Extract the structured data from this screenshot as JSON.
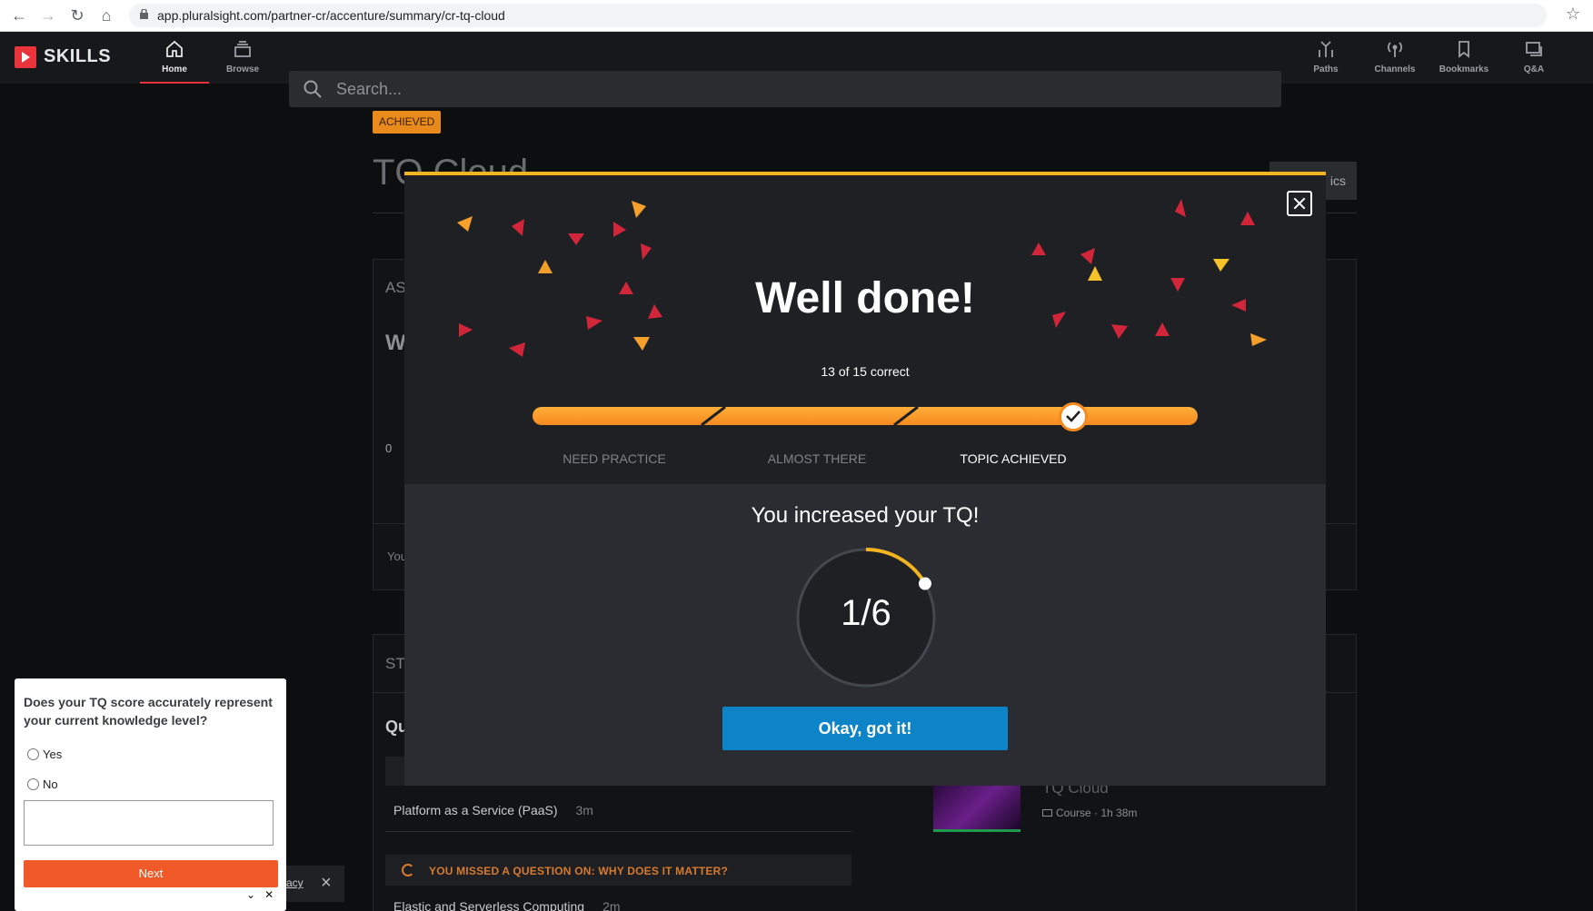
{
  "browser": {
    "url": "app.pluralsight.com/partner-cr/accenture/summary/cr-tq-cloud"
  },
  "header": {
    "logo": "SKILLS",
    "nav": [
      {
        "label": "Home",
        "icon": "home-icon"
      },
      {
        "label": "Browse",
        "icon": "browse-icon"
      },
      {
        "label": "Paths",
        "icon": "paths-icon"
      },
      {
        "label": "Channels",
        "icon": "channels-icon"
      },
      {
        "label": "Bookmarks",
        "icon": "bookmark-icon"
      },
      {
        "label": "Q&A",
        "icon": "qa-icon"
      }
    ],
    "search_placeholder": "Search..."
  },
  "page": {
    "badge": "ACHIEVED",
    "title": "TQ Cloud",
    "topics_button": "ics",
    "panel1_heading": "AS",
    "panel1_sub": "W",
    "panel1_axis": "0",
    "panel1_footer": "You",
    "panel2_heading": "ST",
    "panel2_sub": "Qu",
    "list": [
      {
        "title": "Platform as a Service (PaaS)",
        "time": "3m"
      },
      {
        "title": "Elastic and Serverless Computing",
        "time": "2m"
      }
    ],
    "missed_label": "YOU MISSED A QUESTION ON: WHY DOES IT MATTER?",
    "course": {
      "title": "TQ Cloud",
      "type": "Course",
      "duration": "1h 38m"
    }
  },
  "modal": {
    "headline": "Well done!",
    "score": "13 of 15 correct",
    "stages": [
      "NEED PRACTICE",
      "ALMOST THERE",
      "TOPIC ACHIEVED"
    ],
    "active_stage": "TOPIC ACHIEVED",
    "tq_title": "You increased your TQ!",
    "tq_value": "1/6",
    "tq_fraction": 0.1667,
    "ok_button": "Okay, got it!",
    "colors": {
      "accent": "#f2b320",
      "bar": "#f58a1f",
      "button": "#0e84c8"
    }
  },
  "survey": {
    "question": "Does your TQ score accurately represent your current knowledge level?",
    "options": [
      "Yes",
      "No"
    ],
    "next_button": "Next",
    "privacy_link": "acy"
  }
}
